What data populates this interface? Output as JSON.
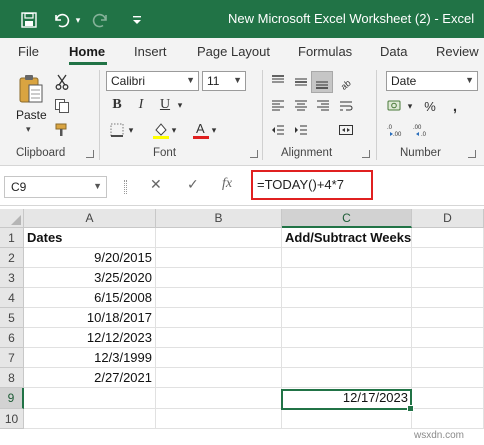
{
  "window": {
    "title": "New Microsoft Excel Worksheet (2)  -  Excel"
  },
  "ribbon_tabs": [
    {
      "label": "File"
    },
    {
      "label": "Home"
    },
    {
      "label": "Insert"
    },
    {
      "label": "Page Layout"
    },
    {
      "label": "Formulas"
    },
    {
      "label": "Data"
    },
    {
      "label": "Review"
    }
  ],
  "clipboard": {
    "group_label": "Clipboard",
    "paste_label": "Paste"
  },
  "font": {
    "group_label": "Font",
    "name": "Calibri",
    "size": "11",
    "highlight_color": "#ffff00",
    "font_color": "#e02020"
  },
  "alignment": {
    "group_label": "Alignment"
  },
  "number": {
    "group_label": "Number",
    "format": "Date"
  },
  "formula_bar": {
    "name_box": "C9",
    "formula": "=TODAY()+4*7"
  },
  "sheet": {
    "columns": [
      "A",
      "B",
      "C",
      "D"
    ],
    "rows": [
      {
        "n": "1",
        "a": "Dates",
        "b": "",
        "c": "Add/Subtract Weeks",
        "d": ""
      },
      {
        "n": "2",
        "a": "9/20/2015",
        "b": "",
        "c": "",
        "d": ""
      },
      {
        "n": "3",
        "a": "3/25/2020",
        "b": "",
        "c": "",
        "d": ""
      },
      {
        "n": "4",
        "a": "6/15/2008",
        "b": "",
        "c": "",
        "d": ""
      },
      {
        "n": "5",
        "a": "10/18/2017",
        "b": "",
        "c": "",
        "d": ""
      },
      {
        "n": "6",
        "a": "12/12/2023",
        "b": "",
        "c": "",
        "d": ""
      },
      {
        "n": "7",
        "a": "12/3/1999",
        "b": "",
        "c": "",
        "d": ""
      },
      {
        "n": "8",
        "a": "2/27/2021",
        "b": "",
        "c": "",
        "d": ""
      },
      {
        "n": "9",
        "a": "",
        "b": "",
        "c": "12/17/2023",
        "d": ""
      },
      {
        "n": "10",
        "a": "",
        "b": "",
        "c": "",
        "d": ""
      }
    ]
  },
  "watermark": "wsxdn.com"
}
